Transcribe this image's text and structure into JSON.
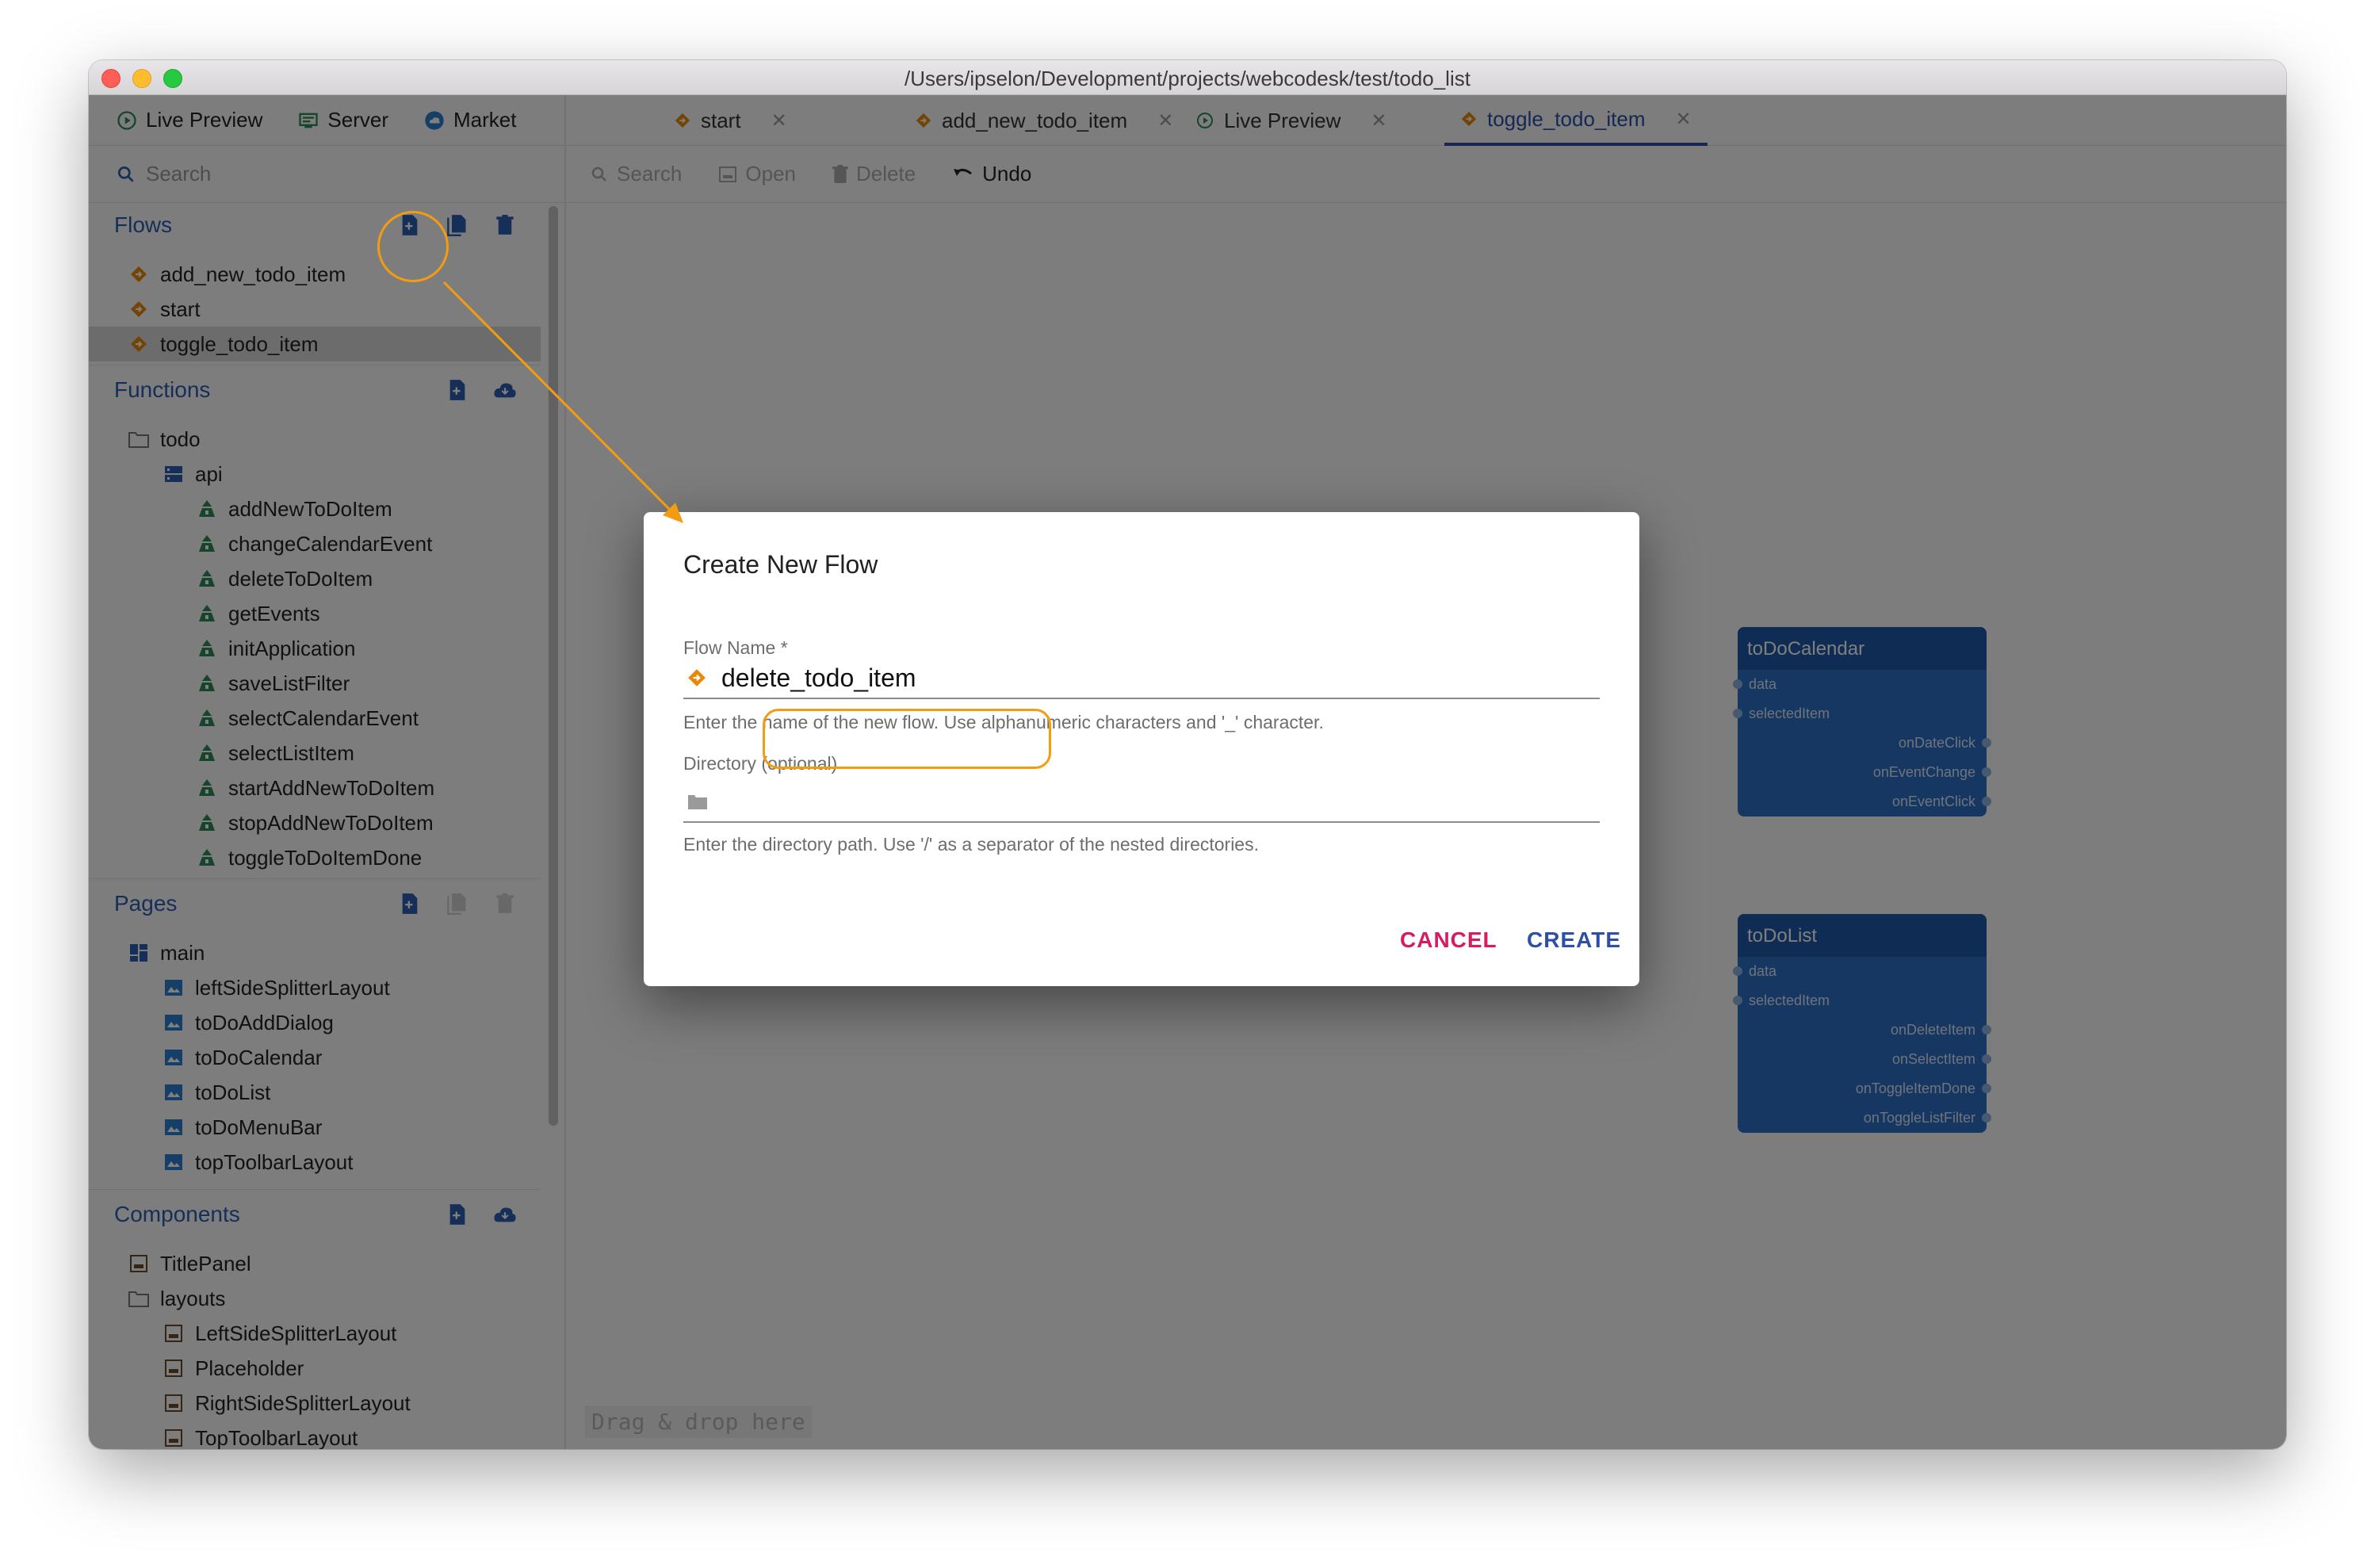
{
  "window": {
    "title": "/Users/ipselon/Development/projects/webcodesk/test/todo_list"
  },
  "topnav": {
    "items": [
      {
        "label": "Live Preview"
      },
      {
        "label": "Server"
      },
      {
        "label": "Market"
      }
    ]
  },
  "left_search": {
    "placeholder": "Search"
  },
  "flows": {
    "title": "Flows",
    "items": [
      {
        "label": "add_new_todo_item"
      },
      {
        "label": "start"
      },
      {
        "label": "toggle_todo_item",
        "selected": true
      }
    ]
  },
  "functions": {
    "title": "Functions",
    "folder": "todo",
    "subfolder": "api",
    "items": [
      "addNewToDoItem",
      "changeCalendarEvent",
      "deleteToDoItem",
      "getEvents",
      "initApplication",
      "saveListFilter",
      "selectCalendarEvent",
      "selectListItem",
      "startAddNewToDoItem",
      "stopAddNewToDoItem",
      "toggleToDoItemDone"
    ]
  },
  "pages": {
    "title": "Pages",
    "root": "main",
    "items": [
      "leftSideSplitterLayout",
      "toDoAddDialog",
      "toDoCalendar",
      "toDoList",
      "toDoMenuBar",
      "topToolbarLayout"
    ]
  },
  "components": {
    "title": "Components",
    "top_item": "TitlePanel",
    "folder": "layouts",
    "items": [
      "LeftSideSplitterLayout",
      "Placeholder",
      "RightSideSplitterLayout",
      "TopToolbarLayout"
    ]
  },
  "tabs": [
    {
      "label": "start"
    },
    {
      "label": "add_new_todo_item"
    },
    {
      "label": "Live Preview"
    },
    {
      "label": "toggle_todo_item",
      "active": true
    }
  ],
  "toolbar": {
    "search": "Search",
    "open": "Open",
    "delete": "Delete",
    "undo": "Undo"
  },
  "canvas": {
    "hint": "Drag & drop here",
    "nodes": [
      {
        "title": "toDoCalendar",
        "inputs": [
          "data",
          "selectedItem"
        ],
        "outputs": [
          "onDateClick",
          "onEventChange",
          "onEventClick"
        ]
      },
      {
        "title": "toDoList",
        "inputs": [
          "data",
          "selectedItem"
        ],
        "outputs": [
          "onDeleteItem",
          "onSelectItem",
          "onToggleItemDone",
          "onToggleListFilter"
        ]
      }
    ]
  },
  "dialog": {
    "title": "Create New Flow",
    "name_label": "Flow Name *",
    "name_value": "delete_todo_item",
    "name_helper": "Enter the name of the new flow. Use alphanumeric characters and '_' character.",
    "dir_label": "Directory (optional)",
    "dir_value": "",
    "dir_helper": "Enter the directory path. Use '/' as a separator of the nested directories.",
    "cancel": "CANCEL",
    "create": "CREATE"
  },
  "colors": {
    "accent": "#2d4fa6",
    "cancel": "#d81b60",
    "annotation": "#f39c12",
    "node": "#2c6fc4",
    "flow_icon": "#e8890c",
    "function_icon": "#2e8b57",
    "page_icon": "#2d5fb0"
  }
}
